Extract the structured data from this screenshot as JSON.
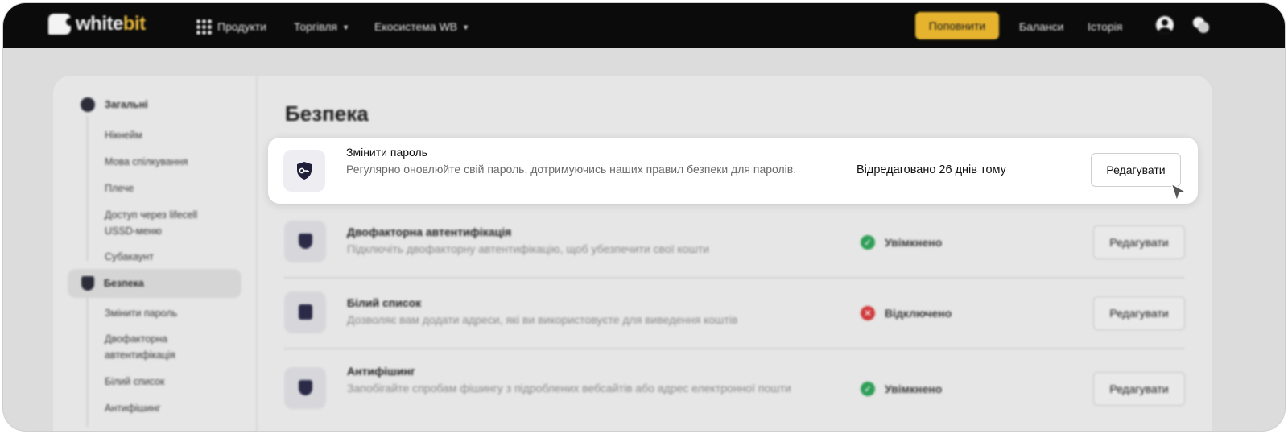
{
  "header": {
    "logo_white": "white",
    "logo_bit": "bit",
    "nav": [
      {
        "label": "Продукти"
      },
      {
        "label": "Торгівля"
      },
      {
        "label": "Екосистема WB"
      }
    ],
    "deposit_label": "Поповнити",
    "balances_label": "Баланси",
    "history_label": "Історія"
  },
  "sidebar": {
    "general": {
      "label": "Загальні",
      "items": [
        "Нікнейм",
        "Мова спілкування",
        "Плече",
        "Доступ через lifecell USSD-меню",
        "Субакаунт"
      ]
    },
    "security": {
      "label": "Безпека",
      "items": [
        "Змінити пароль",
        "Двофакторна автентифікація",
        "Білий список",
        "Антифішинг"
      ]
    }
  },
  "main": {
    "title": "Безпека",
    "rows": [
      {
        "title": "Змінити пароль",
        "description": "Регулярно оновлюйте свій пароль, дотримуючись наших правил безпеки для паролів.",
        "status": "Відредаговано 26 днів тому",
        "button": "Редагувати"
      },
      {
        "title": "Двофакторна автентифікація",
        "description": "Підключіть двофакторну автентифікацію, щоб убезпечити свої кошти",
        "status": "Увімкнено",
        "button": "Редагувати"
      },
      {
        "title": "Білий список",
        "description": "Дозволяє вам додати адреси, які ви використовуєте для виведення коштів",
        "status": "Відключено",
        "button": "Редагувати"
      },
      {
        "title": "Антифішинг",
        "description": "Запобігайте спробам фішингу з підроблених вебсайтів або адрес електронної пошти",
        "status": "Увімкнено",
        "button": "Редагувати"
      }
    ]
  },
  "colors": {
    "accent": "#e6b32e",
    "enabled": "#2f9e57",
    "disabled": "#d0393b",
    "topbar": "#0b0b0b"
  }
}
